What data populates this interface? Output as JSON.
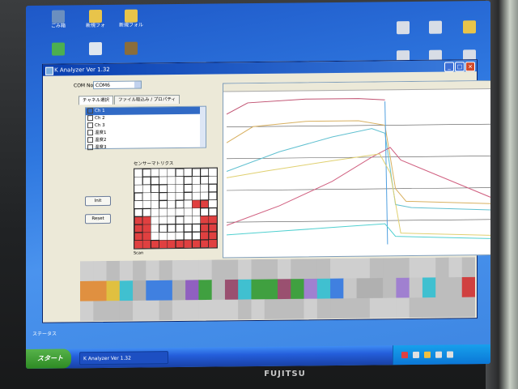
{
  "desktop_icons": [
    {
      "label": "ごみ箱",
      "color": "#6b8fbf"
    },
    {
      "label": "新規フォ",
      "color": "#e8c44a"
    },
    {
      "label": "新規フォル",
      "color": "#e8c44a"
    },
    {
      "label": "",
      "color": "#4caf50"
    },
    {
      "label": "",
      "color": "#dfe6ee"
    },
    {
      "label": "",
      "color": "#8a6d3b"
    }
  ],
  "app": {
    "title": "K Analyzer Ver 1.32",
    "com_label": "COM No.",
    "com_value": "COM6",
    "tabs": [
      "チャネル選択",
      "ファイル取込み / プロパティ"
    ],
    "channels": [
      {
        "label": "Ch 1",
        "selected": true
      },
      {
        "label": "Ch 2",
        "selected": false
      },
      {
        "label": "Ch 3",
        "selected": false
      },
      {
        "label": "温度1",
        "selected": false
      },
      {
        "label": "温度2",
        "selected": false
      },
      {
        "label": "温度3",
        "selected": false
      }
    ],
    "init_label": "Init",
    "reset_label": "Reset",
    "grid_label": "センサーマトリクス",
    "grid_footer": "Scan",
    "accent": "#316ac5"
  },
  "taskbar": {
    "start_label": "スタート",
    "task_label": "K Analyzer Ver 1.32",
    "status": "ステータス"
  },
  "brand": "FUJITSU",
  "chart_data": {
    "type": "line",
    "xlim": [
      0,
      100
    ],
    "ylim": [
      0,
      100
    ],
    "grid": true,
    "series": [
      {
        "color": "#c05070",
        "values": [
          [
            0,
            88
          ],
          [
            8,
            95
          ],
          [
            30,
            97
          ],
          [
            50,
            97
          ],
          [
            60,
            96
          ]
        ]
      },
      {
        "color": "#d8b060",
        "values": [
          [
            0,
            70
          ],
          [
            10,
            80
          ],
          [
            30,
            83
          ],
          [
            50,
            83
          ],
          [
            60,
            80
          ],
          [
            64,
            40
          ],
          [
            68,
            32
          ],
          [
            100,
            30
          ]
        ]
      },
      {
        "color": "#60c0d0",
        "values": [
          [
            0,
            52
          ],
          [
            20,
            64
          ],
          [
            40,
            73
          ],
          [
            55,
            78
          ],
          [
            60,
            75
          ],
          [
            64,
            30
          ],
          [
            70,
            28
          ],
          [
            100,
            26
          ]
        ]
      },
      {
        "color": "#d06080",
        "values": [
          [
            0,
            18
          ],
          [
            20,
            30
          ],
          [
            40,
            45
          ],
          [
            55,
            60
          ],
          [
            62,
            66
          ],
          [
            66,
            58
          ],
          [
            100,
            34
          ]
        ]
      },
      {
        "color": "#50a0e0",
        "values": [
          [
            60,
            95
          ],
          [
            61,
            5
          ]
        ]
      },
      {
        "color": "#e0d070",
        "values": [
          [
            0,
            48
          ],
          [
            15,
            52
          ],
          [
            40,
            58
          ],
          [
            58,
            62
          ],
          [
            62,
            50
          ],
          [
            66,
            12
          ],
          [
            100,
            10
          ]
        ]
      },
      {
        "color": "#50d0d0",
        "values": [
          [
            0,
            12
          ],
          [
            20,
            14
          ],
          [
            40,
            16
          ],
          [
            60,
            18
          ],
          [
            64,
            10
          ],
          [
            100,
            8
          ]
        ]
      }
    ]
  }
}
